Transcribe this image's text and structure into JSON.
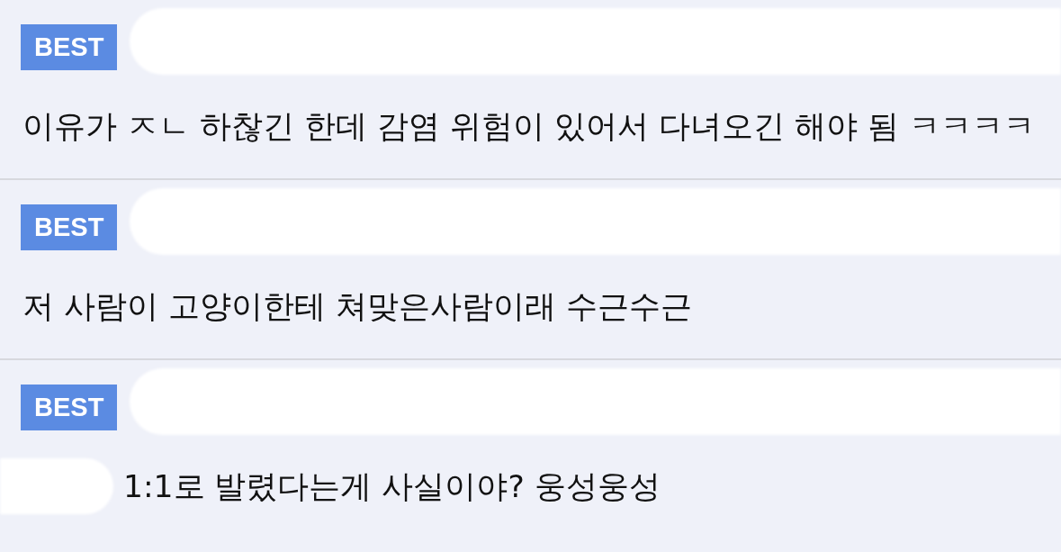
{
  "comments": [
    {
      "badge": "BEST",
      "prefix_hidden": false,
      "text": "이유가 ㅈㄴ 하찮긴 한데 감염 위험이 있어서 다녀오긴 해야 됨 ㅋㅋㅋㅋ"
    },
    {
      "badge": "BEST",
      "prefix_hidden": false,
      "text": "저 사람이 고양이한테 쳐맞은사람이래 수근수근"
    },
    {
      "badge": "BEST",
      "prefix_hidden": true,
      "text": "1:1로 발렸다는게 사실이야? 웅성웅성"
    }
  ]
}
